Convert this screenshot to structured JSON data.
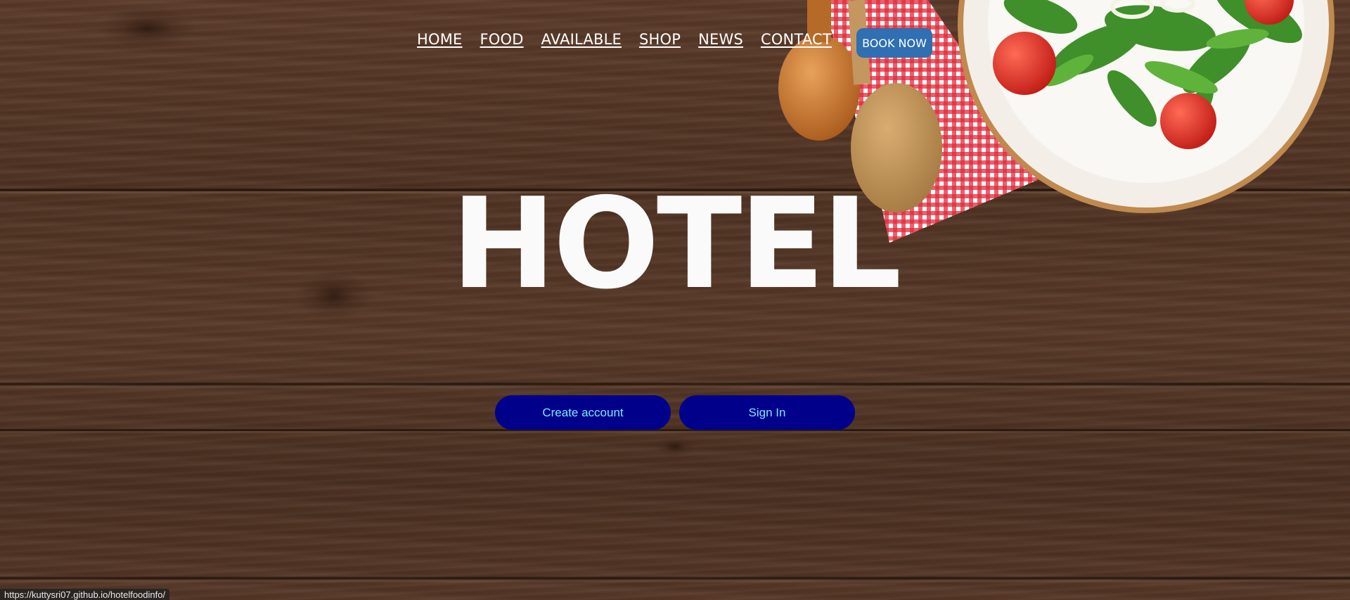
{
  "nav": {
    "items": [
      "HOME",
      "FOOD",
      "AVAILABLE",
      "SHOP",
      "NEWS",
      "CONTACT"
    ],
    "book_label": "BOOK NOW"
  },
  "hero": {
    "title": "HOTEL"
  },
  "auth": {
    "create_label": "Create account",
    "signin_label": "Sign In"
  },
  "status_bar": {
    "url": "https://kuttysri07.github.io/hotelfoodinfo/"
  },
  "colors": {
    "book_button": "#2f6fb2",
    "auth_button": "#00008b",
    "auth_text": "#7fe6ff",
    "wood": "#553626"
  }
}
